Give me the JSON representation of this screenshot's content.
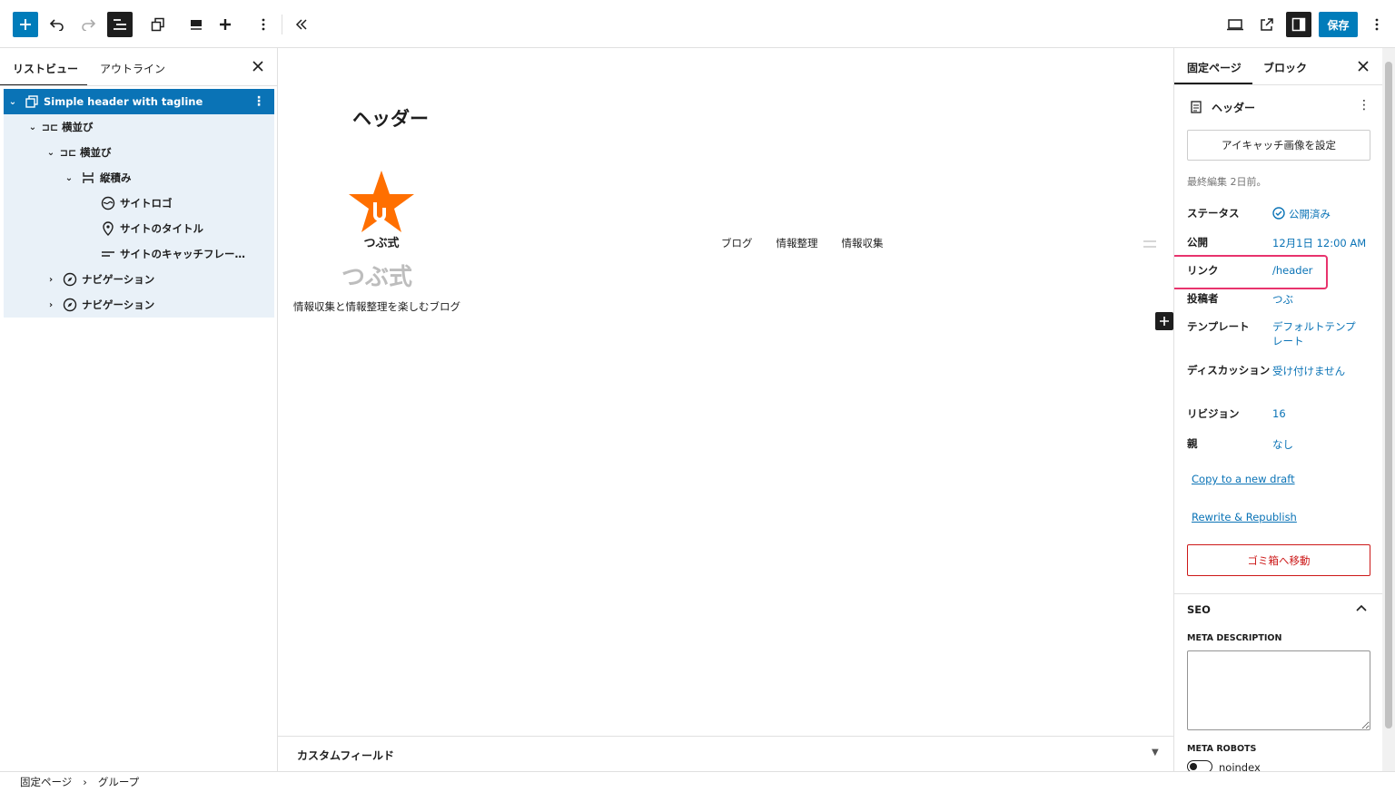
{
  "toolbar": {
    "icons": [
      "plus-icon",
      "undo-icon",
      "redo-icon",
      "list-view-icon",
      "block-patterns-icon",
      "align-icon",
      "insert-after-icon",
      "more-vertical-icon",
      "collapse-icon",
      "desktop-preview-icon",
      "external-view-icon",
      "sidebar-icon",
      "more-vertical-icon"
    ],
    "save_label": "保存",
    "accent": "#007cba"
  },
  "listview": {
    "tab_list": "リストビュー",
    "tab_outline": "アウトライン",
    "items": [
      {
        "label": "Simple header with tagline",
        "icon": "group-icon",
        "selected": true
      },
      {
        "label": "横並び",
        "icon": "row-icon"
      },
      {
        "label": "横並び",
        "icon": "row-icon"
      },
      {
        "label": "縦積み",
        "icon": "stack-icon"
      },
      {
        "label": "サイトロゴ",
        "icon": "site-logo-icon"
      },
      {
        "label": "サイトのタイトル",
        "icon": "location-icon"
      },
      {
        "label": "サイトのキャッチフレー…",
        "icon": "tagline-icon"
      },
      {
        "label": "ナビゲーション",
        "icon": "navigation-icon"
      },
      {
        "label": "ナビゲーション",
        "icon": "navigation-icon"
      }
    ]
  },
  "canvas": {
    "page_title": "ヘッダー",
    "logo_text": "つぶ式",
    "site_title": "つぶ式",
    "tagline": "情報収集と情報整理を楽しむブログ",
    "nav": [
      "ブログ",
      "情報整理",
      "情報収集"
    ],
    "logo_color": "#ff6f00"
  },
  "custom_fields": {
    "label": "カスタムフィールド"
  },
  "sidebar": {
    "tab_page": "固定ページ",
    "tab_block": "ブロック",
    "doc_title": "ヘッダー",
    "featured_button": "アイキャッチ画像を設定",
    "last_edited": "最終編集 2日前。",
    "rows": {
      "status_label": "ステータス",
      "status_value": "公開済み",
      "publish_label": "公開",
      "publish_value": "12月1日 12:00 AM",
      "link_label": "リンク",
      "link_value": "/header",
      "author_label": "投稿者",
      "author_value": "つぶ",
      "template_label": "テンプレート",
      "template_value": "デフォルトテンプレート",
      "discussion_label": "ディスカッション",
      "discussion_value": "受け付けません",
      "revision_label": "リビジョン",
      "revision_value": "16",
      "parent_label": "親",
      "parent_value": "なし"
    },
    "copy_draft": "Copy to a new draft",
    "rewrite": "Rewrite & Republish",
    "trash": "ゴミ箱へ移動",
    "seo_title": "SEO",
    "meta_description": "META DESCRIPTION",
    "meta_robots": "META ROBOTS",
    "noindex": "noindex",
    "highlight_color": "#e8336d"
  },
  "breadcrumb": {
    "root": "固定ページ",
    "separator": "›",
    "current": "グループ"
  }
}
